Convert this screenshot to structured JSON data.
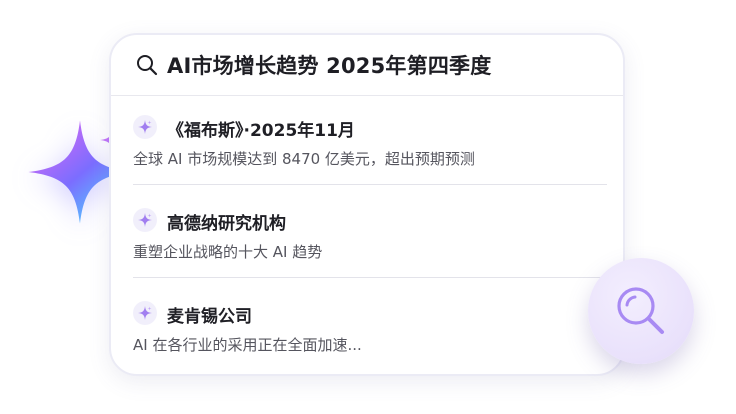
{
  "search": {
    "query": "AI市场增长趋势 2025年第四季度"
  },
  "results": [
    {
      "title": "《福布斯》·2025年11月",
      "description": "全球 AI 市场规模达到 8470 亿美元，超出预期预测"
    },
    {
      "title": "高德纳研究机构",
      "description": "重塑企业战略的十大 AI 趋势"
    },
    {
      "title": "麦肯锡公司",
      "description": "AI 在各行业的采用正在全面加速..."
    }
  ],
  "icons": {
    "search": "search-icon",
    "result_badge": "sparkle-icon",
    "floating_button": "magnifier-icon",
    "decoration": "sparkle-icon"
  },
  "colors": {
    "accent": "#9b7cf2",
    "sparkle_gradient": [
      "#c06bf4",
      "#7c73ff",
      "#5fd6ff"
    ]
  }
}
